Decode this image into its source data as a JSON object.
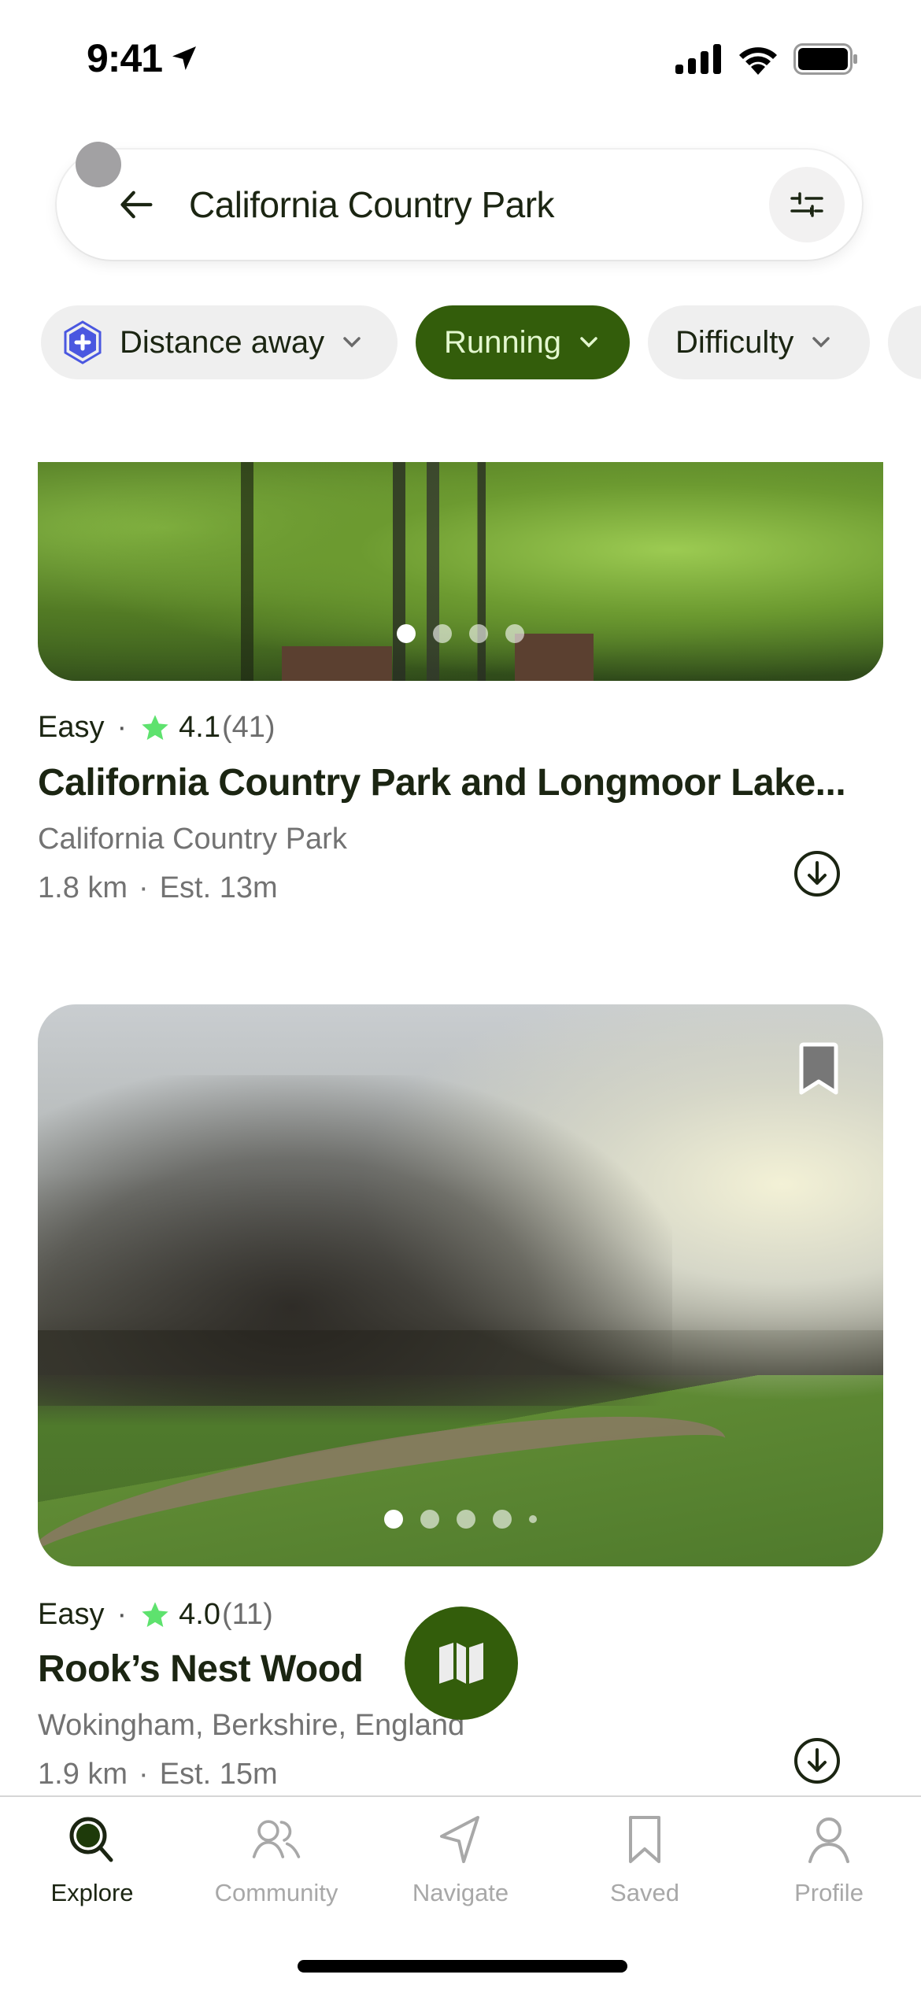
{
  "status_bar": {
    "time": "9:41",
    "icons": [
      "location-arrow-icon",
      "cellular-signal-icon",
      "wifi-icon",
      "battery-icon"
    ]
  },
  "search": {
    "value": "California Country Park",
    "back_icon": "arrow-left-icon",
    "filter_icon": "sliders-icon"
  },
  "filters": [
    {
      "label": "Distance away",
      "icon": "plus-hexagon-icon",
      "active": false
    },
    {
      "label": "Running",
      "active": true
    },
    {
      "label": "Difficulty",
      "active": false
    },
    {
      "label": "",
      "active": false
    }
  ],
  "colors": {
    "brand_green": "#335d0b",
    "chip_active_text": "#e3f7cf",
    "chip_bg": "#efefef",
    "star": "#5ee26e",
    "hex_icon": "#4a57e0",
    "text_primary": "#1b2512",
    "text_secondary": "#737373",
    "tab_inactive": "#a8a8a8"
  },
  "results": [
    {
      "difficulty": "Easy",
      "rating": "4.1",
      "review_count": "(41)",
      "title": "California Country Park and Longmoor Lake...",
      "location": "California Country Park",
      "distance": "1.8 km",
      "duration": "Est. 13m",
      "image_pages": 4,
      "image_active_page": 1
    },
    {
      "difficulty": "Easy",
      "rating": "4.0",
      "review_count": "(11)",
      "title": "Rook’s Nest Wood",
      "location": "Wokingham, Berkshire, England",
      "distance": "1.9 km",
      "duration": "Est. 15m",
      "image_pages": 5,
      "image_active_page": 1,
      "saved_icon": "bookmark-icon"
    }
  ],
  "map_button": {
    "icon": "map-icon"
  },
  "tabbar": {
    "items": [
      {
        "label": "Explore",
        "icon": "search-icon",
        "active": true
      },
      {
        "label": "Community",
        "icon": "community-icon",
        "active": false
      },
      {
        "label": "Navigate",
        "icon": "navigate-icon",
        "active": false
      },
      {
        "label": "Saved",
        "icon": "bookmark-icon",
        "active": false
      },
      {
        "label": "Profile",
        "icon": "profile-icon",
        "active": false
      }
    ]
  }
}
